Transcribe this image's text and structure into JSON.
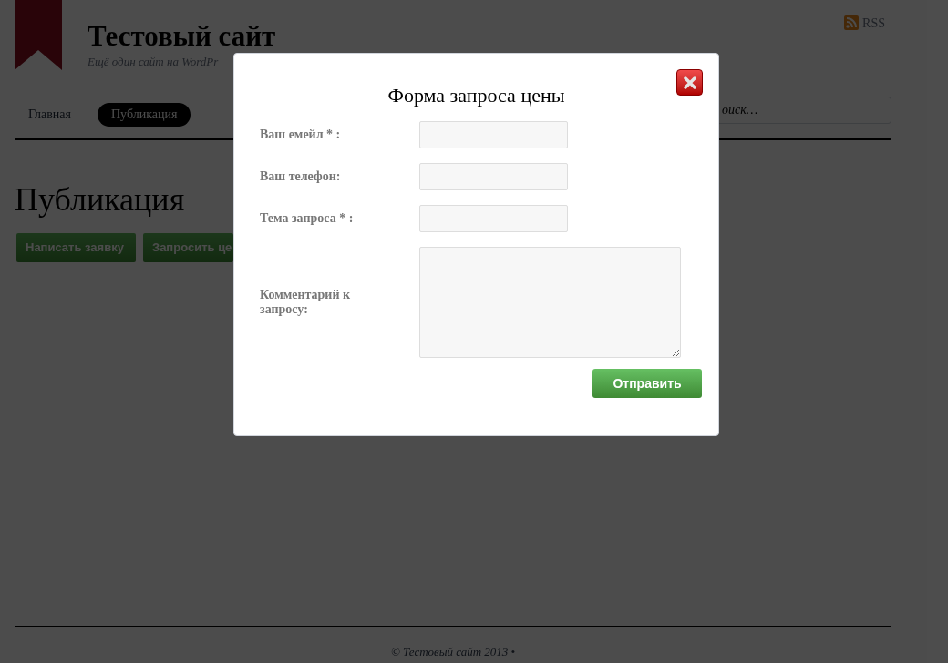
{
  "site": {
    "title": "Тестовый сайт",
    "tagline": "Ещё один сайт на WordPr",
    "rss": "RSS"
  },
  "nav": [
    {
      "label": "Главная",
      "selected": false
    },
    {
      "label": "Публикация",
      "selected": true
    }
  ],
  "search": {
    "placeholder": "оиск…"
  },
  "page": {
    "heading": "Публикация",
    "buttons": [
      "Написать заявку",
      "Запросить це"
    ]
  },
  "footer": "© Тестовый сайт 2013 •",
  "modal": {
    "title": "Форма запроса цены",
    "fields": [
      {
        "label": "Ваш емейл * :",
        "kind": "input"
      },
      {
        "label": "Ваш телефон:",
        "kind": "input"
      },
      {
        "label": "Тема запроса * :",
        "kind": "input"
      },
      {
        "label": "Комментарий к запросу:",
        "kind": "textarea"
      }
    ],
    "submit": "Отправить"
  }
}
